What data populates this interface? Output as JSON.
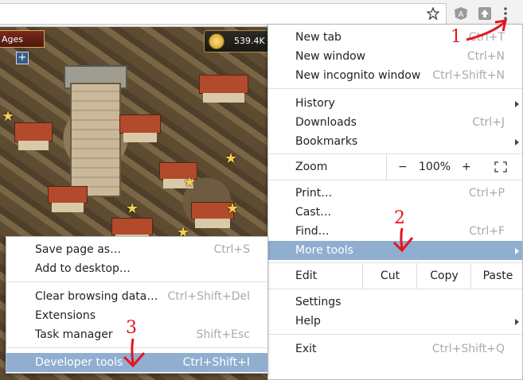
{
  "game": {
    "ages_label": "Ages",
    "coins_value": "539.4K"
  },
  "menu": {
    "new_tab": {
      "label": "New tab",
      "shortcut": "Ctrl+T"
    },
    "new_window": {
      "label": "New window",
      "shortcut": "Ctrl+N"
    },
    "new_incognito": {
      "label": "New incognito window",
      "shortcut": "Ctrl+Shift+N"
    },
    "history": {
      "label": "History"
    },
    "downloads": {
      "label": "Downloads",
      "shortcut": "Ctrl+J"
    },
    "bookmarks": {
      "label": "Bookmarks"
    },
    "zoom": {
      "label": "Zoom",
      "minus": "−",
      "value": "100%",
      "plus": "+"
    },
    "print": {
      "label": "Print…",
      "shortcut": "Ctrl+P"
    },
    "cast": {
      "label": "Cast…"
    },
    "find": {
      "label": "Find…",
      "shortcut": "Ctrl+F"
    },
    "more_tools": {
      "label": "More tools"
    },
    "edit": {
      "label": "Edit",
      "cut": "Cut",
      "copy": "Copy",
      "paste": "Paste"
    },
    "settings": {
      "label": "Settings"
    },
    "help": {
      "label": "Help"
    },
    "exit": {
      "label": "Exit",
      "shortcut": "Ctrl+Shift+Q"
    }
  },
  "submenu": {
    "save_page": {
      "label": "Save page as…",
      "shortcut": "Ctrl+S"
    },
    "add_desktop": {
      "label": "Add to desktop…"
    },
    "clear_data": {
      "label": "Clear browsing data…",
      "shortcut": "Ctrl+Shift+Del"
    },
    "extensions": {
      "label": "Extensions"
    },
    "task_manager": {
      "label": "Task manager",
      "shortcut": "Shift+Esc"
    },
    "developer_tools": {
      "label": "Developer tools",
      "shortcut": "Ctrl+Shift+I"
    }
  },
  "annotations": {
    "step1": "1",
    "step2": "2",
    "step3": "3"
  },
  "colors": {
    "highlight": "#90aed0",
    "annotation": "#e8141c"
  }
}
